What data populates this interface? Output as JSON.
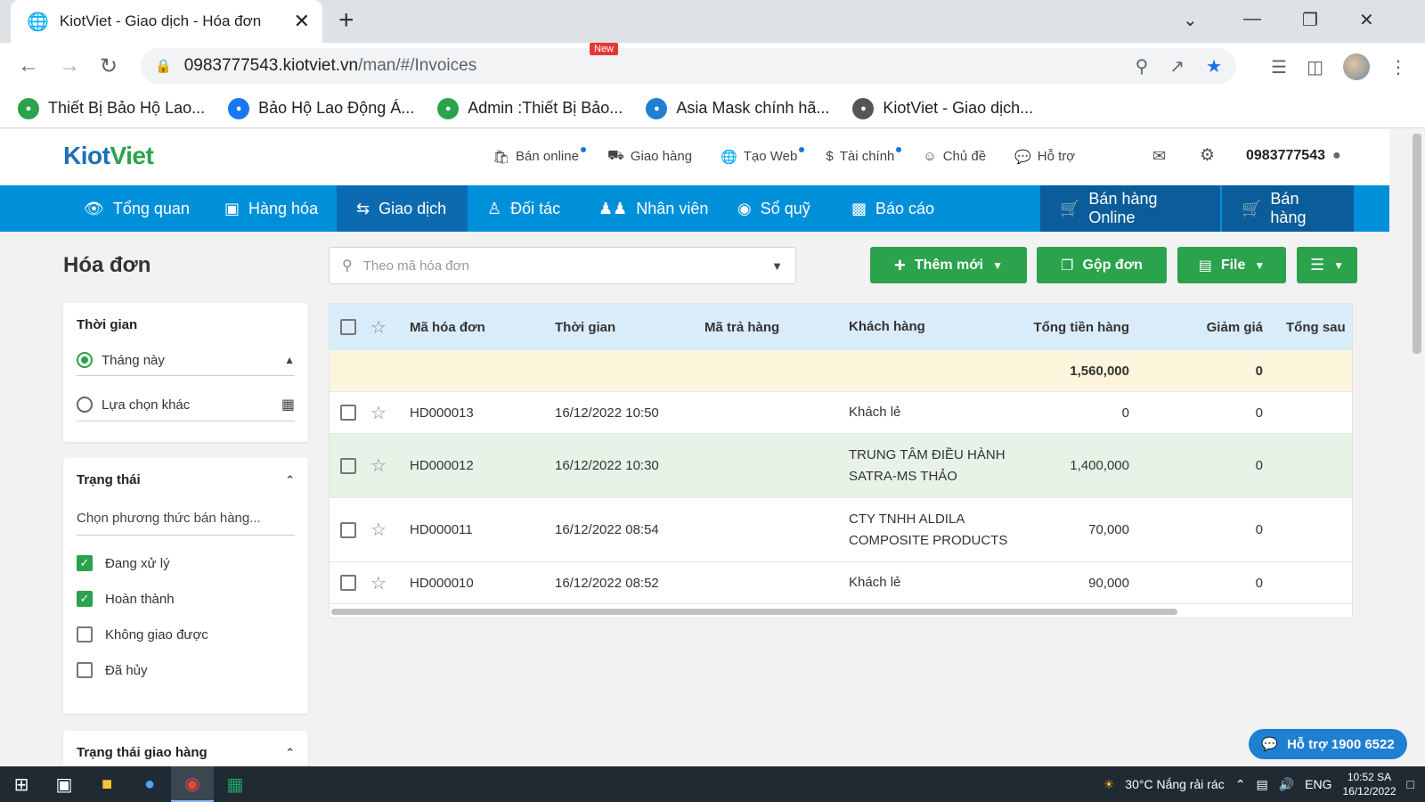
{
  "browser": {
    "tab_title": "KiotViet - Giao dịch - Hóa đơn",
    "url_host": "0983777543.kiotviet.vn",
    "url_path": "/man/#/Invoices",
    "bookmarks": [
      {
        "label": "Thiết Bị Bảo Hộ Lao...",
        "icon": "asia-safe-icon",
        "color": "#2ba24c"
      },
      {
        "label": "Bảo Hộ Lao Động Á...",
        "icon": "facebook-icon",
        "color": "#1877f2"
      },
      {
        "label": "Admin :Thiết Bị Bảo...",
        "icon": "wave-icon",
        "color": "#2ba24c"
      },
      {
        "label": "Asia Mask chính hã...",
        "icon": "globe-cross-icon",
        "color": "#1f7fd1"
      },
      {
        "label": "KiotViet - Giao dịch...",
        "icon": "globe-icon",
        "color": "#555"
      }
    ]
  },
  "app": {
    "logo_main": "Kiot",
    "logo_accent": "Viet",
    "topnav": [
      {
        "label": "Bán online",
        "icon": "bag-icon",
        "dot": true
      },
      {
        "label": "Giao hàng",
        "icon": "truck-icon",
        "dot": false
      },
      {
        "label": "Tạo Web",
        "icon": "globe-icon",
        "dot": true
      },
      {
        "label": "Tài chính",
        "icon": "dollar-icon",
        "dot": true
      },
      {
        "label": "Chủ đề",
        "icon": "palette-icon",
        "dot": false
      },
      {
        "label": "Hỗ trợ",
        "icon": "chat-icon",
        "dot": false
      }
    ],
    "phone": "0983777543",
    "new_badge": "New",
    "mainnav": [
      {
        "label": "Tổng quan",
        "icon": "eye-icon"
      },
      {
        "label": "Hàng hóa",
        "icon": "box-icon"
      },
      {
        "label": "Giao dịch",
        "icon": "exchange-icon"
      },
      {
        "label": "Đối tác",
        "icon": "person-icon"
      },
      {
        "label": "Nhân viên",
        "icon": "people-icon"
      },
      {
        "label": "Sổ quỹ",
        "icon": "coin-icon"
      },
      {
        "label": "Báo cáo",
        "icon": "chart-icon"
      }
    ],
    "online_sales": "Bán hàng Online",
    "sales": "Bán hàng"
  },
  "page": {
    "title": "Hóa đơn",
    "search_placeholder": "Theo mã hóa đơn",
    "btn_add": "Thêm mới",
    "btn_merge": "Gộp đơn",
    "btn_file": "File"
  },
  "filters": {
    "time_title": "Thời gian",
    "time_this_month": "Tháng này",
    "time_other": "Lựa chọn khác",
    "status_title": "Trạng thái",
    "sales_method_placeholder": "Chọn phương thức bán hàng...",
    "statuses": [
      {
        "label": "Đang xử lý",
        "checked": true
      },
      {
        "label": "Hoàn thành",
        "checked": true
      },
      {
        "label": "Không giao được",
        "checked": false
      },
      {
        "label": "Đã hủy",
        "checked": false
      }
    ],
    "delivery_title": "Trạng thái giao hàng"
  },
  "grid": {
    "headers": {
      "code": "Mã hóa đơn",
      "time": "Thời gian",
      "return_code": "Mã trả hàng",
      "customer": "Khách hàng",
      "total": "Tổng tiền hàng",
      "discount": "Giảm giá",
      "after": "Tổng sau"
    },
    "summary": {
      "total": "1,560,000",
      "discount": "0"
    },
    "rows": [
      {
        "code": "HD000013",
        "time": "16/12/2022 10:50",
        "return_code": "",
        "customer": "Khách lẻ",
        "total": "0",
        "discount": "0"
      },
      {
        "code": "HD000012",
        "time": "16/12/2022 10:30",
        "return_code": "",
        "customer": "TRUNG TÂM ĐIỀU HÀNH SATRA-MS THẢO",
        "total": "1,400,000",
        "discount": "0"
      },
      {
        "code": "HD000011",
        "time": "16/12/2022 08:54",
        "return_code": "",
        "customer": "CTY TNHH ALDILA COMPOSITE PRODUCTS",
        "total": "70,000",
        "discount": "0"
      },
      {
        "code": "HD000010",
        "time": "16/12/2022 08:52",
        "return_code": "",
        "customer": "Khách lẻ",
        "total": "90,000",
        "discount": "0"
      }
    ]
  },
  "support": "Hỗ trợ 1900 6522",
  "taskbar": {
    "weather": "30°C  Nắng rải rác",
    "lang": "ENG",
    "time": "10:52 SA",
    "date": "16/12/2022"
  }
}
